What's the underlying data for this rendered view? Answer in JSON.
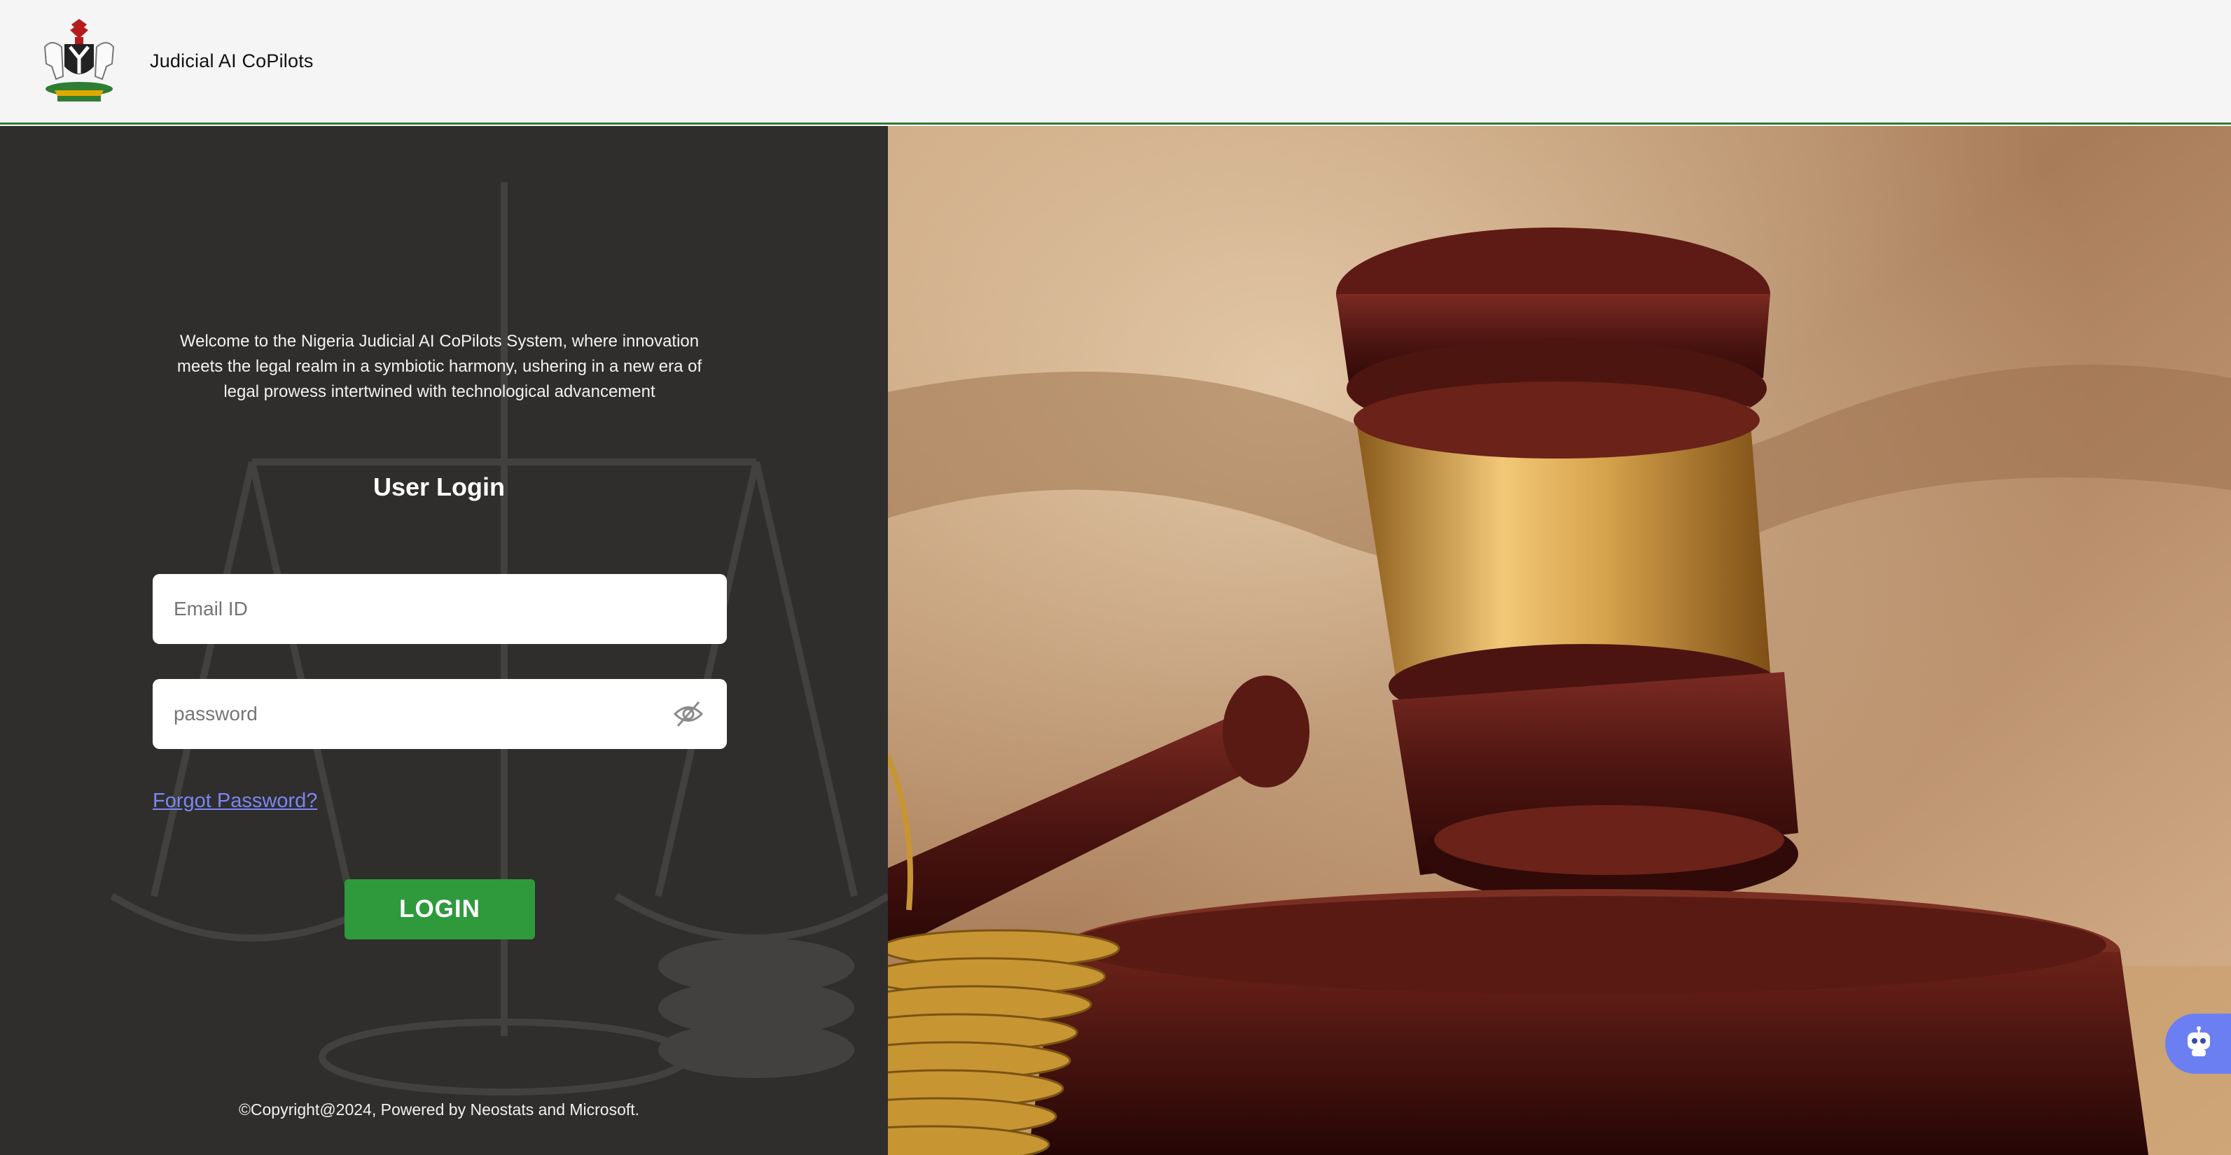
{
  "header": {
    "app_title": "Judicial AI CoPilots",
    "logo_icon": "nigeria-coat-of-arms-icon"
  },
  "login": {
    "welcome_text": "Welcome to the Nigeria Judicial AI CoPilots System, where innovation meets the legal realm in a symbiotic harmony, ushering in a new era of legal prowess intertwined with technological advancement",
    "heading": "User Login",
    "email_placeholder": "Email ID",
    "password_placeholder": "password",
    "password_toggle_icon": "eye-off-icon",
    "forgot_password": "Forgot Password?",
    "login_button": "LOGIN"
  },
  "footer": {
    "copyright": "©Copyright@2024, Powered by Neostats and Microsoft."
  },
  "chatbot": {
    "icon": "robot-icon"
  },
  "colors": {
    "header_bg": "#f5f5f5",
    "header_border": "#2e7d32",
    "panel_bg": "#2f2e2c",
    "login_button": "#2e9a3c",
    "link": "#7b86f5",
    "chat_button": "#6b7ff2"
  }
}
